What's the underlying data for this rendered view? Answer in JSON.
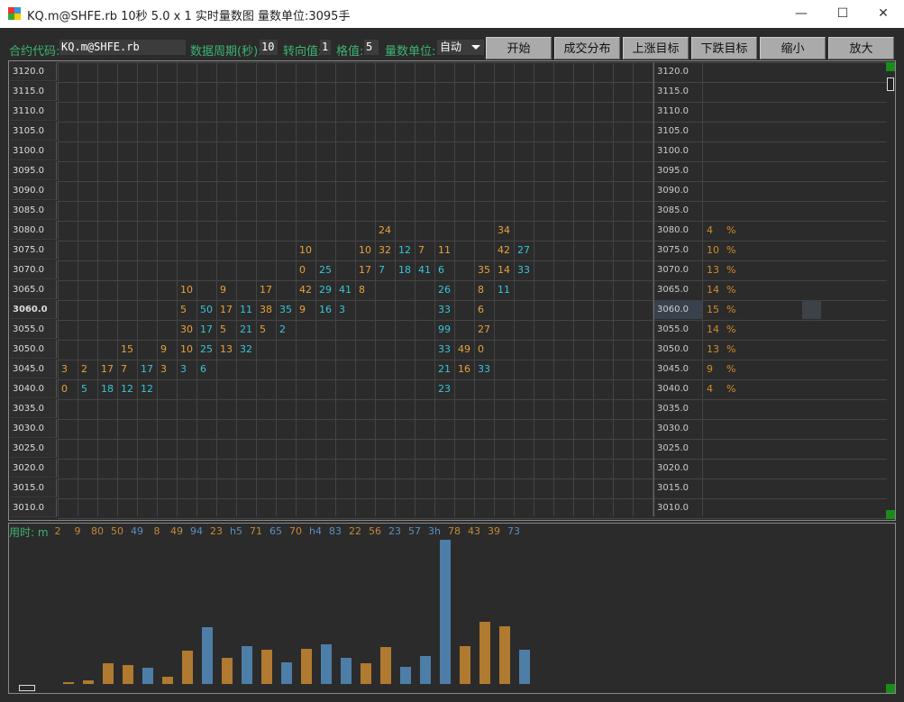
{
  "window": {
    "title": "KQ.m@SHFE.rb 10秒  5.0 x 1 实时量数图 量数单位:3095手",
    "minimize": "—",
    "maximize": "☐",
    "close": "✕"
  },
  "toolbar": {
    "contract_label": "合约代码:",
    "contract_value": "KQ.m@SHFE.rb",
    "period_label": "数据周期(秒):",
    "period_value": "10",
    "turn_label": "转向值:",
    "turn_value": "1",
    "grid_label": "格值:",
    "grid_value": "5",
    "unit_label": "量数单位:",
    "unit_value": "自动",
    "buttons": [
      "开始",
      "成交分布",
      "上涨目标",
      "下跌目标",
      "缩小",
      "放大"
    ]
  },
  "prices": [
    "3120.0",
    "3115.0",
    "3110.0",
    "3105.0",
    "3100.0",
    "3095.0",
    "3090.0",
    "3085.0",
    "3080.0",
    "3075.0",
    "3070.0",
    "3065.0",
    "3060.0",
    "3055.0",
    "3050.0",
    "3045.0",
    "3040.0",
    "3035.0",
    "3030.0",
    "3025.0",
    "3020.0",
    "3015.0",
    "3010.0"
  ],
  "highlight_price": "3060.0",
  "cells": [
    [
      "3080.0",
      16,
      "24",
      "o"
    ],
    [
      "3080.0",
      22,
      "34",
      "o"
    ],
    [
      "3075.0",
      12,
      "10",
      "o"
    ],
    [
      "3075.0",
      15,
      "10",
      "o"
    ],
    [
      "3075.0",
      16,
      "32",
      "o"
    ],
    [
      "3075.0",
      17,
      "12",
      "c"
    ],
    [
      "3075.0",
      18,
      "7",
      "o"
    ],
    [
      "3075.0",
      19,
      "11",
      "o"
    ],
    [
      "3075.0",
      22,
      "42",
      "o"
    ],
    [
      "3075.0",
      23,
      "27",
      "c"
    ],
    [
      "3070.0",
      12,
      "0",
      "o"
    ],
    [
      "3070.0",
      13,
      "25",
      "c"
    ],
    [
      "3070.0",
      15,
      "17",
      "o"
    ],
    [
      "3070.0",
      16,
      "7",
      "c"
    ],
    [
      "3070.0",
      17,
      "18",
      "c"
    ],
    [
      "3070.0",
      18,
      "41",
      "c"
    ],
    [
      "3070.0",
      19,
      "6",
      "c"
    ],
    [
      "3070.0",
      21,
      "35",
      "o"
    ],
    [
      "3070.0",
      22,
      "14",
      "o"
    ],
    [
      "3070.0",
      23,
      "33",
      "c"
    ],
    [
      "3065.0",
      6,
      "10",
      "o"
    ],
    [
      "3065.0",
      8,
      "9",
      "o"
    ],
    [
      "3065.0",
      10,
      "17",
      "o"
    ],
    [
      "3065.0",
      12,
      "42",
      "o"
    ],
    [
      "3065.0",
      13,
      "29",
      "c"
    ],
    [
      "3065.0",
      14,
      "41",
      "c"
    ],
    [
      "3065.0",
      15,
      "8",
      "o"
    ],
    [
      "3065.0",
      19,
      "26",
      "c"
    ],
    [
      "3065.0",
      21,
      "8",
      "o"
    ],
    [
      "3065.0",
      22,
      "11",
      "c"
    ],
    [
      "3060.0",
      6,
      "5",
      "o"
    ],
    [
      "3060.0",
      7,
      "50",
      "c"
    ],
    [
      "3060.0",
      8,
      "17",
      "o"
    ],
    [
      "3060.0",
      9,
      "11",
      "c"
    ],
    [
      "3060.0",
      10,
      "38",
      "o"
    ],
    [
      "3060.0",
      11,
      "35",
      "c"
    ],
    [
      "3060.0",
      12,
      "9",
      "o"
    ],
    [
      "3060.0",
      13,
      "16",
      "c"
    ],
    [
      "3060.0",
      14,
      "3",
      "c"
    ],
    [
      "3060.0",
      19,
      "33",
      "c"
    ],
    [
      "3060.0",
      21,
      "6",
      "o"
    ],
    [
      "3055.0",
      6,
      "30",
      "o"
    ],
    [
      "3055.0",
      7,
      "17",
      "c"
    ],
    [
      "3055.0",
      8,
      "5",
      "o"
    ],
    [
      "3055.0",
      9,
      "21",
      "c"
    ],
    [
      "3055.0",
      10,
      "5",
      "o"
    ],
    [
      "3055.0",
      11,
      "2",
      "c"
    ],
    [
      "3055.0",
      19,
      "99",
      "c"
    ],
    [
      "3055.0",
      21,
      "27",
      "o"
    ],
    [
      "3050.0",
      3,
      "15",
      "o"
    ],
    [
      "3050.0",
      5,
      "9",
      "o"
    ],
    [
      "3050.0",
      6,
      "10",
      "o"
    ],
    [
      "3050.0",
      7,
      "25",
      "c"
    ],
    [
      "3050.0",
      8,
      "13",
      "o"
    ],
    [
      "3050.0",
      9,
      "32",
      "c"
    ],
    [
      "3050.0",
      19,
      "33",
      "c"
    ],
    [
      "3050.0",
      20,
      "49",
      "o"
    ],
    [
      "3050.0",
      21,
      "0",
      "o"
    ],
    [
      "3045.0",
      0,
      "3",
      "o"
    ],
    [
      "3045.0",
      1,
      "2",
      "o"
    ],
    [
      "3045.0",
      2,
      "17",
      "o"
    ],
    [
      "3045.0",
      3,
      "7",
      "o"
    ],
    [
      "3045.0",
      4,
      "17",
      "c"
    ],
    [
      "3045.0",
      5,
      "3",
      "o"
    ],
    [
      "3045.0",
      6,
      "3",
      "c"
    ],
    [
      "3045.0",
      7,
      "6",
      "c"
    ],
    [
      "3045.0",
      19,
      "21",
      "c"
    ],
    [
      "3045.0",
      20,
      "16",
      "o"
    ],
    [
      "3045.0",
      21,
      "33",
      "c"
    ],
    [
      "3040.0",
      0,
      "0",
      "o"
    ],
    [
      "3040.0",
      1,
      "5",
      "c"
    ],
    [
      "3040.0",
      2,
      "18",
      "c"
    ],
    [
      "3040.0",
      3,
      "12",
      "c"
    ],
    [
      "3040.0",
      4,
      "12",
      "c"
    ],
    [
      "3040.0",
      19,
      "23",
      "c"
    ]
  ],
  "distribution": [
    [
      "3080.0",
      "4"
    ],
    [
      "3075.0",
      "10"
    ],
    [
      "3070.0",
      "13"
    ],
    [
      "3065.0",
      "14"
    ],
    [
      "3060.0",
      "15"
    ],
    [
      "3055.0",
      "14"
    ],
    [
      "3050.0",
      "13"
    ],
    [
      "3045.0",
      "9"
    ],
    [
      "3040.0",
      "4"
    ]
  ],
  "pct_symbol": "%",
  "time_label": "用时: m",
  "time_values": [
    "2",
    "9",
    "80",
    "50",
    "49",
    "8",
    "49",
    "94",
    "23",
    "h5",
    "71",
    "65",
    "70",
    "h4",
    "83",
    "22",
    "56",
    "23",
    "57",
    "3h",
    "78",
    "43",
    "39",
    "73"
  ],
  "bars": [
    {
      "v": 2,
      "c": "o"
    },
    {
      "v": 4,
      "c": "o"
    },
    {
      "v": 23,
      "c": "o"
    },
    {
      "v": 21,
      "c": "o"
    },
    {
      "v": 18,
      "c": "b"
    },
    {
      "v": 8,
      "c": "o"
    },
    {
      "v": 37,
      "c": "o"
    },
    {
      "v": 63,
      "c": "b"
    },
    {
      "v": 29,
      "c": "o"
    },
    {
      "v": 42,
      "c": "b"
    },
    {
      "v": 38,
      "c": "o"
    },
    {
      "v": 24,
      "c": "b"
    },
    {
      "v": 39,
      "c": "o"
    },
    {
      "v": 44,
      "c": "b"
    },
    {
      "v": 29,
      "c": "b"
    },
    {
      "v": 23,
      "c": "o"
    },
    {
      "v": 41,
      "c": "o"
    },
    {
      "v": 19,
      "c": "b"
    },
    {
      "v": 31,
      "c": "b"
    },
    {
      "v": 160,
      "c": "b"
    },
    {
      "v": 42,
      "c": "o"
    },
    {
      "v": 69,
      "c": "o"
    },
    {
      "v": 64,
      "c": "o"
    },
    {
      "v": 38,
      "c": "b"
    }
  ],
  "colors": {
    "accent_green": "#3cb371",
    "orange": "#e8a23a",
    "cyan": "#36c6d8",
    "bar_orange": "#b07a30",
    "bar_blue": "#4d7ea8"
  }
}
